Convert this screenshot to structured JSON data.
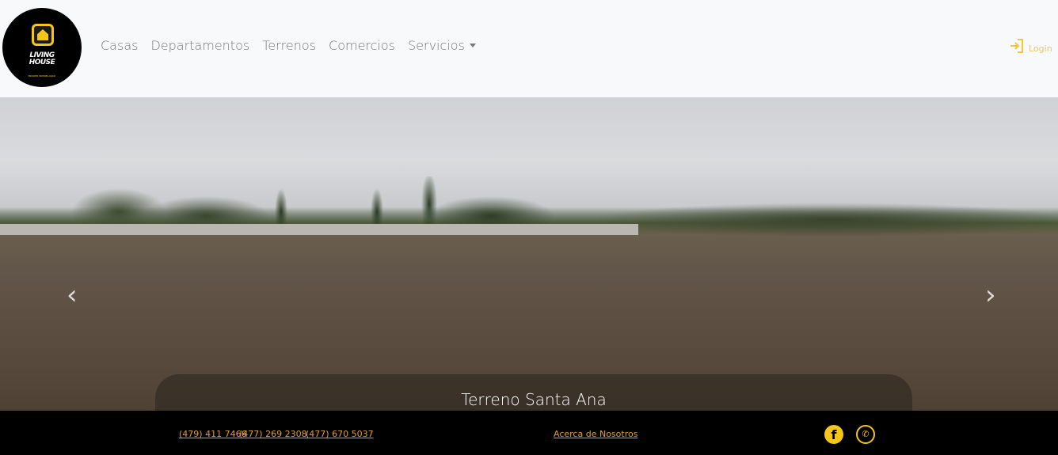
{
  "logo": {
    "line1": "LIVING",
    "line2": "HOUSE",
    "tagline": "BROKER INMOBILIARIO"
  },
  "nav": {
    "items": [
      "Casas",
      "Departamentos",
      "Terrenos",
      "Comercios"
    ],
    "dropdown": "Servicios",
    "login": "Login"
  },
  "carousel": {
    "caption": "Terreno Santa Ana",
    "prev": "‹",
    "next": "›"
  },
  "footer": {
    "phones": [
      "(479) 411 7466",
      "(477) 269 2308",
      "(477) 670 5037"
    ],
    "about": "Acerca de Nosotros",
    "facebook": "f",
    "whatsapp": "✆"
  }
}
